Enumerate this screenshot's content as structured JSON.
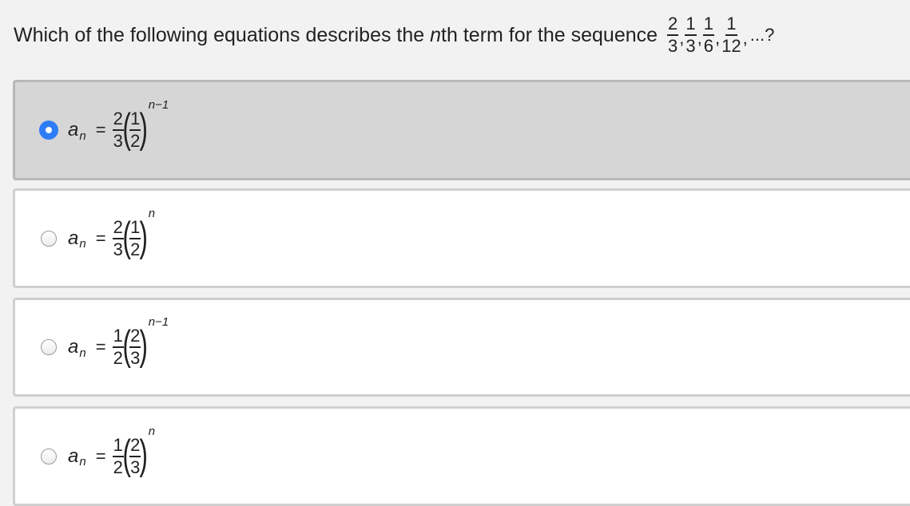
{
  "question": {
    "text_before": "Which of the following equations describes the ",
    "text_italic": "n",
    "text_after": "th term for the sequence",
    "sequence": [
      {
        "num": "2",
        "den": "3"
      },
      {
        "num": "1",
        "den": "3"
      },
      {
        "num": "1",
        "den": "6"
      },
      {
        "num": "1",
        "den": "12"
      }
    ],
    "separator": ",",
    "tail": "...?"
  },
  "options": [
    {
      "selected": true,
      "lhs": "a",
      "lhs_sub": "n",
      "eq": "=",
      "coef_num": "2",
      "coef_den": "3",
      "base_num": "1",
      "base_den": "2",
      "exponent": "n−1"
    },
    {
      "selected": false,
      "lhs": "a",
      "lhs_sub": "n",
      "eq": "=",
      "coef_num": "2",
      "coef_den": "3",
      "base_num": "1",
      "base_den": "2",
      "exponent": "n"
    },
    {
      "selected": false,
      "lhs": "a",
      "lhs_sub": "n",
      "eq": "=",
      "coef_num": "1",
      "coef_den": "2",
      "base_num": "2",
      "base_den": "3",
      "exponent": "n−1"
    },
    {
      "selected": false,
      "lhs": "a",
      "lhs_sub": "n",
      "eq": "=",
      "coef_num": "1",
      "coef_den": "2",
      "base_num": "2",
      "base_den": "3",
      "exponent": "n"
    }
  ],
  "colors": {
    "radio_selected": "#2f7df6",
    "selected_background": "#d6d6d6",
    "page_background": "#f2f2f2"
  },
  "icons": {
    "radio_checked": "radio-checked-icon",
    "radio_unchecked": "radio-unchecked-icon"
  }
}
